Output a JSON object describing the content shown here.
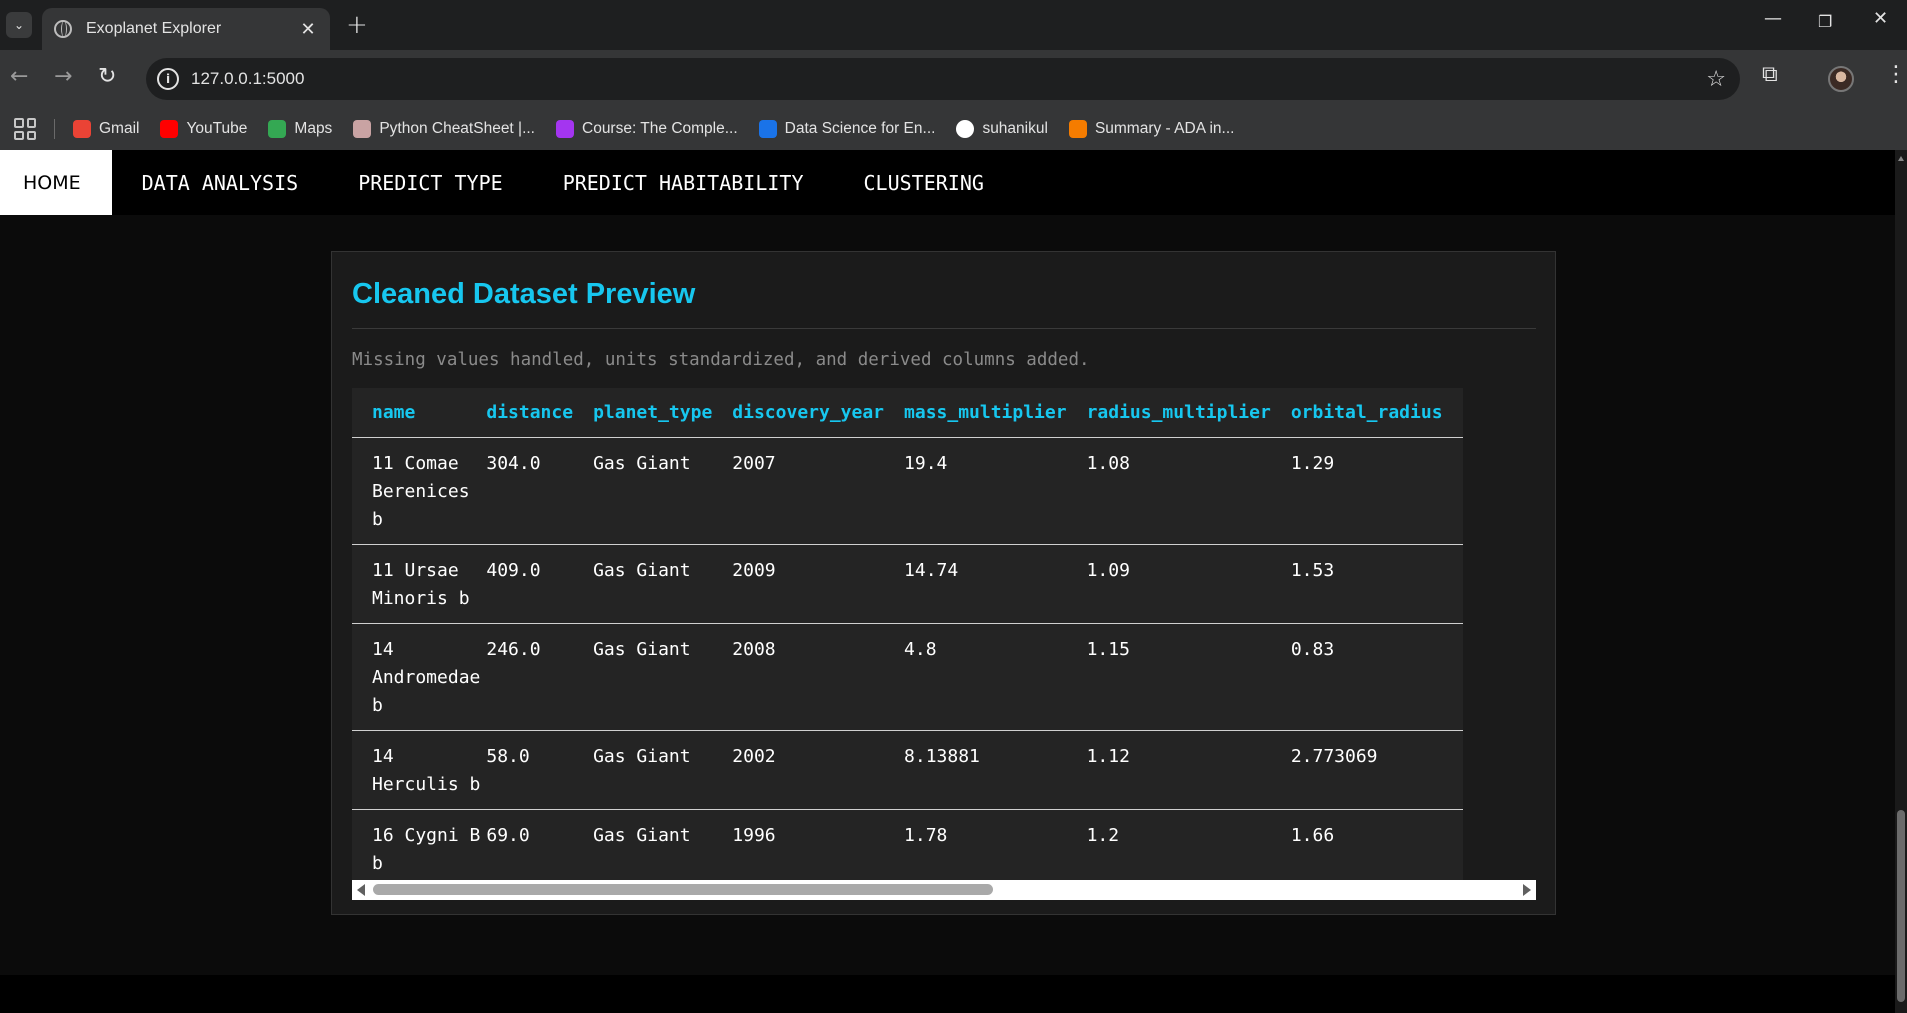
{
  "browser": {
    "tab_title": "Exoplanet Explorer",
    "url": "127.0.0.1:5000",
    "bookmarks": [
      {
        "label": "Gmail",
        "icon": "gmail-icon",
        "color": "#ea4335"
      },
      {
        "label": "YouTube",
        "icon": "youtube-icon",
        "color": "#ff0000"
      },
      {
        "label": "Maps",
        "icon": "maps-icon",
        "color": "#34a853"
      },
      {
        "label": "Python CheatSheet |...",
        "icon": "avatar-icon",
        "color": "#c9a3a3"
      },
      {
        "label": "Course: The Comple...",
        "icon": "udemy-icon",
        "color": "#a435f0"
      },
      {
        "label": "Data Science for En...",
        "icon": "s-logo-icon",
        "color": "#1a73e8"
      },
      {
        "label": "suhanikul",
        "icon": "github-icon",
        "color": "#ffffff"
      },
      {
        "label": "Summary - ADA in...",
        "icon": "cloud-icon",
        "color": "#f57c00"
      }
    ]
  },
  "nav": {
    "items": [
      "HOME",
      "DATA ANALYSIS",
      "PREDICT TYPE",
      "PREDICT HABITABILITY",
      "CLUSTERING"
    ],
    "active": "HOME"
  },
  "card": {
    "title": "Cleaned Dataset Preview",
    "subtitle": "Missing values handled, units standardized, and derived columns added."
  },
  "table": {
    "columns": [
      "name",
      "distance",
      "planet_type",
      "discovery_year",
      "mass_multiplier",
      "radius_multiplier",
      "orbital_radius"
    ],
    "rows": [
      [
        "11 Comae Berenices b",
        "304.0",
        "Gas Giant",
        "2007",
        "19.4",
        "1.08",
        "1.29"
      ],
      [
        "11 Ursae Minoris b",
        "409.0",
        "Gas Giant",
        "2009",
        "14.74",
        "1.09",
        "1.53"
      ],
      [
        "14 Andromedae b",
        "246.0",
        "Gas Giant",
        "2008",
        "4.8",
        "1.15",
        "0.83"
      ],
      [
        "14 Herculis b",
        "58.0",
        "Gas Giant",
        "2002",
        "8.13881",
        "1.12",
        "2.773069"
      ],
      [
        "16 Cygni B b",
        "69.0",
        "Gas Giant",
        "1996",
        "1.78",
        "1.2",
        "1.66"
      ]
    ]
  },
  "theme": {
    "accent": "#17c7ef",
    "background": "#0b0b0b",
    "card": "#1b1b1b"
  }
}
